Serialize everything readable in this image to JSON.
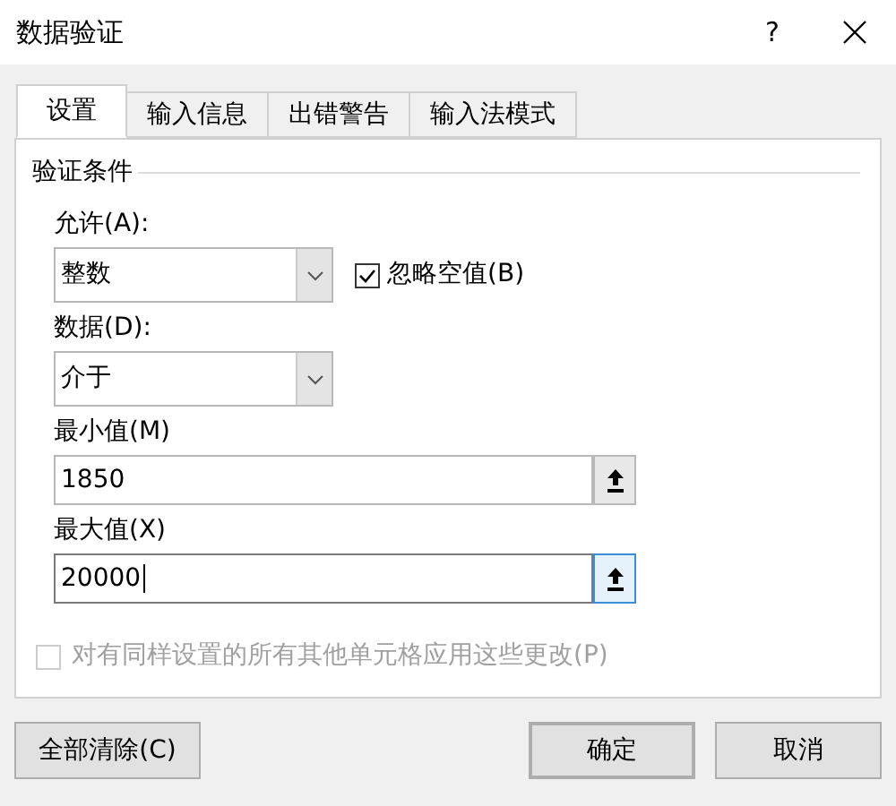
{
  "window": {
    "title": "数据验证",
    "help": "?"
  },
  "tabs": [
    {
      "label": "设置",
      "selected": true
    },
    {
      "label": "输入信息",
      "selected": false
    },
    {
      "label": "出错警告",
      "selected": false
    },
    {
      "label": "输入法模式",
      "selected": false
    }
  ],
  "group_title": "验证条件",
  "allow": {
    "label": "允许(A):",
    "value": "整数"
  },
  "ignore_blank": {
    "label": "忽略空值(B)",
    "checked": true
  },
  "data": {
    "label": "数据(D):",
    "value": "介于"
  },
  "minimum": {
    "label": "最小值(M)",
    "value": "1850",
    "focused": false
  },
  "maximum": {
    "label": "最大值(X)",
    "value": "20000",
    "focused": true
  },
  "apply_all": {
    "label": "对有同样设置的所有其他单元格应用这些更改(P)",
    "checked": false,
    "disabled": true
  },
  "buttons": [
    {
      "label": "全部清除(C)",
      "kind": "clear"
    },
    {
      "label": "确定",
      "kind": "ok"
    },
    {
      "label": "取消",
      "kind": "cancel"
    }
  ]
}
